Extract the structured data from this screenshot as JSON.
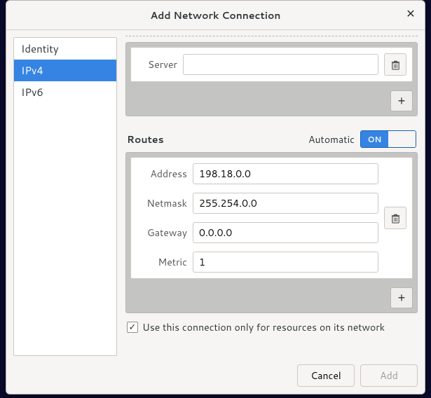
{
  "dialog": {
    "title": "Add Network Connection"
  },
  "sidebar": {
    "items": [
      {
        "label": "Identity",
        "selected": false
      },
      {
        "label": "IPv4",
        "selected": true
      },
      {
        "label": "IPv6",
        "selected": false
      }
    ]
  },
  "server": {
    "label": "Server",
    "value": ""
  },
  "routes": {
    "heading": "Routes",
    "automatic_label": "Automatic",
    "automatic_on_text": "ON",
    "automatic": true,
    "fields": {
      "address_label": "Address",
      "address_value": "198.18.0.0",
      "netmask_label": "Netmask",
      "netmask_value": "255.254.0.0",
      "gateway_label": "Gateway",
      "gateway_value": "0.0.0.0",
      "metric_label": "Metric",
      "metric_value": "1"
    }
  },
  "only_resources": {
    "label": "Use this connection only for resources on its network",
    "checked": true
  },
  "actions": {
    "cancel": "Cancel",
    "add": "Add"
  }
}
